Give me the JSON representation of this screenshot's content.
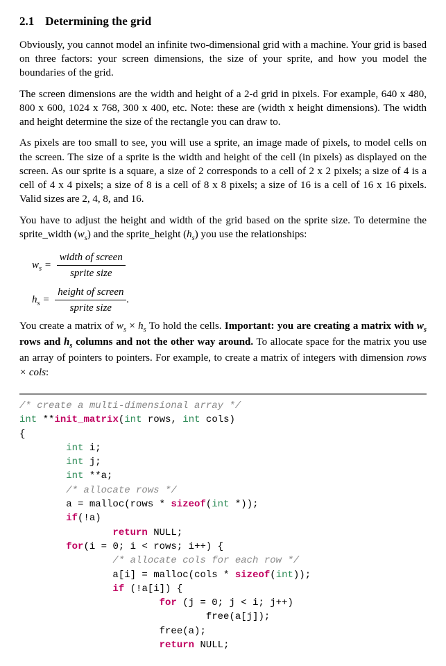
{
  "section": {
    "number": "2.1",
    "title": "Determining the grid"
  },
  "paragraphs": {
    "p1": "Obviously, you cannot model an infinite two-dimensional grid with a machine. Your grid is based on three factors: your screen dimensions, the size of your sprite, and how you model the boundaries of the grid.",
    "p2": "The screen dimensions are the width and height of a 2-d grid in pixels. For example, 640 x 480, 800 x 600, 1024 x 768, 300 x 400, etc. Note: these are (width x height dimensions). The width and height determine the size of the rectangle you can draw to.",
    "p3": "As pixels are too small to see, you will use a sprite, an image made of pixels, to model cells on the screen. The size of a sprite is the width and height of the cell (in pixels) as displayed on the screen. As our sprite is a square, a size of 2 corresponds to a cell of 2 x 2 pixels; a size of 4 is a cell of 4 x 4 pixels; a size of 8 is a cell of 8 x 8 pixels; a size of 16 is a cell of 16 x 16 pixels. Valid sizes are 2, 4, 8, and 16.",
    "p4a": "You have to adjust the height and width of the grid based on the sprite size. To determine the sprite_width (",
    "p4b": ") and the sprite_height (",
    "p4c": ") you use the relationships:",
    "p5a": "You create a matrix of ",
    "p5b": " To hold the cells. ",
    "p5c": "Important: you are creating a matrix with ",
    "p5d": " rows and ",
    "p5e": " columns and not the other way around.",
    "p5f": " To allocate space for the matrix you use an array of pointers to pointers. For example, to create a matrix of integers with dimension ",
    "p5g": ":"
  },
  "math": {
    "ws": "w",
    "ws_sub": "s",
    "hs": "h",
    "hs_sub": "s",
    "eq": " = ",
    "frac1_num": "width of screen",
    "frac1_den": "sprite size",
    "frac2_num": "height of screen",
    "frac2_den": "sprite size",
    "period": ".",
    "times": " × ",
    "rows_cols": "rows × cols"
  },
  "code": {
    "c1": "/* create a multi-dimensional array */",
    "c2a": "int",
    "c2b": " **",
    "c2c": "init_matrix",
    "c2d": "(",
    "c2e": "int",
    "c2f": " rows, ",
    "c2g": "int",
    "c2h": " cols)",
    "c3": "{",
    "c4a": "        ",
    "c4b": "int",
    "c4c": " i;",
    "c5a": "        ",
    "c5b": "int",
    "c5c": " j;",
    "c6a": "        ",
    "c6b": "int",
    "c6c": " **a;",
    "c7a": "        ",
    "c7b": "/* allocate rows */",
    "c8a": "        a = malloc(rows * ",
    "c8b": "sizeof",
    "c8c": "(",
    "c8d": "int",
    "c8e": " *));",
    "c9a": "        ",
    "c9b": "if",
    "c9c": "(!a)",
    "c10a": "                ",
    "c10b": "return",
    "c10c": " NULL;",
    "c11a": "        ",
    "c11b": "for",
    "c11c": "(i = 0; i < rows; i++) {",
    "c12a": "                ",
    "c12b": "/* allocate cols for each row */",
    "c13a": "                a[i] = malloc(cols * ",
    "c13b": "sizeof",
    "c13c": "(",
    "c13d": "int",
    "c13e": "));",
    "c14a": "                ",
    "c14b": "if",
    "c14c": " (!a[i]) {",
    "c15a": "                        ",
    "c15b": "for",
    "c15c": " (j = 0; j < i; j++)",
    "c16": "                                free(a[j]);",
    "c17": "                        free(a);",
    "c18a": "                        ",
    "c18b": "return",
    "c18c": " NULL;"
  }
}
